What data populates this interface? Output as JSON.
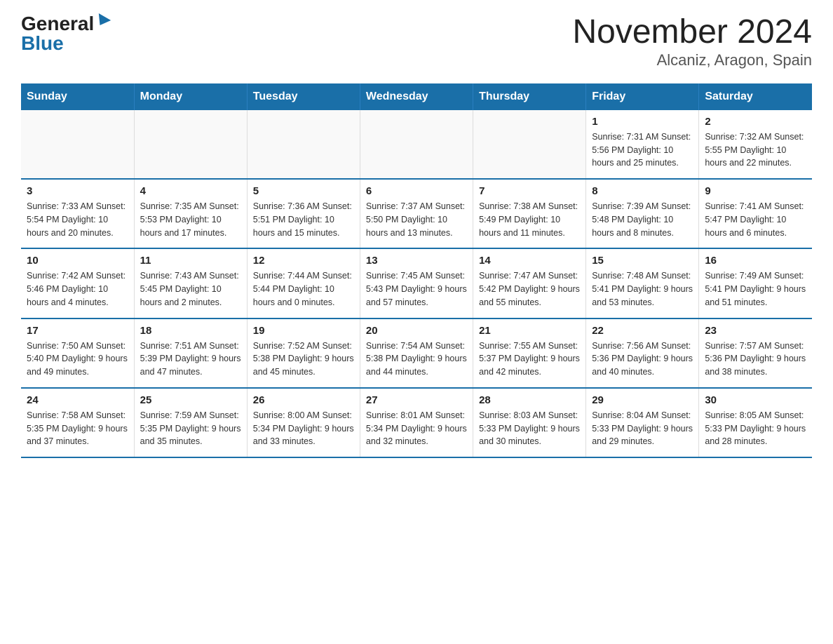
{
  "logo": {
    "general": "General",
    "blue": "Blue"
  },
  "title": "November 2024",
  "subtitle": "Alcaniz, Aragon, Spain",
  "days_of_week": [
    "Sunday",
    "Monday",
    "Tuesday",
    "Wednesday",
    "Thursday",
    "Friday",
    "Saturday"
  ],
  "weeks": [
    [
      {
        "day": "",
        "info": ""
      },
      {
        "day": "",
        "info": ""
      },
      {
        "day": "",
        "info": ""
      },
      {
        "day": "",
        "info": ""
      },
      {
        "day": "",
        "info": ""
      },
      {
        "day": "1",
        "info": "Sunrise: 7:31 AM\nSunset: 5:56 PM\nDaylight: 10 hours\nand 25 minutes."
      },
      {
        "day": "2",
        "info": "Sunrise: 7:32 AM\nSunset: 5:55 PM\nDaylight: 10 hours\nand 22 minutes."
      }
    ],
    [
      {
        "day": "3",
        "info": "Sunrise: 7:33 AM\nSunset: 5:54 PM\nDaylight: 10 hours\nand 20 minutes."
      },
      {
        "day": "4",
        "info": "Sunrise: 7:35 AM\nSunset: 5:53 PM\nDaylight: 10 hours\nand 17 minutes."
      },
      {
        "day": "5",
        "info": "Sunrise: 7:36 AM\nSunset: 5:51 PM\nDaylight: 10 hours\nand 15 minutes."
      },
      {
        "day": "6",
        "info": "Sunrise: 7:37 AM\nSunset: 5:50 PM\nDaylight: 10 hours\nand 13 minutes."
      },
      {
        "day": "7",
        "info": "Sunrise: 7:38 AM\nSunset: 5:49 PM\nDaylight: 10 hours\nand 11 minutes."
      },
      {
        "day": "8",
        "info": "Sunrise: 7:39 AM\nSunset: 5:48 PM\nDaylight: 10 hours\nand 8 minutes."
      },
      {
        "day": "9",
        "info": "Sunrise: 7:41 AM\nSunset: 5:47 PM\nDaylight: 10 hours\nand 6 minutes."
      }
    ],
    [
      {
        "day": "10",
        "info": "Sunrise: 7:42 AM\nSunset: 5:46 PM\nDaylight: 10 hours\nand 4 minutes."
      },
      {
        "day": "11",
        "info": "Sunrise: 7:43 AM\nSunset: 5:45 PM\nDaylight: 10 hours\nand 2 minutes."
      },
      {
        "day": "12",
        "info": "Sunrise: 7:44 AM\nSunset: 5:44 PM\nDaylight: 10 hours\nand 0 minutes."
      },
      {
        "day": "13",
        "info": "Sunrise: 7:45 AM\nSunset: 5:43 PM\nDaylight: 9 hours\nand 57 minutes."
      },
      {
        "day": "14",
        "info": "Sunrise: 7:47 AM\nSunset: 5:42 PM\nDaylight: 9 hours\nand 55 minutes."
      },
      {
        "day": "15",
        "info": "Sunrise: 7:48 AM\nSunset: 5:41 PM\nDaylight: 9 hours\nand 53 minutes."
      },
      {
        "day": "16",
        "info": "Sunrise: 7:49 AM\nSunset: 5:41 PM\nDaylight: 9 hours\nand 51 minutes."
      }
    ],
    [
      {
        "day": "17",
        "info": "Sunrise: 7:50 AM\nSunset: 5:40 PM\nDaylight: 9 hours\nand 49 minutes."
      },
      {
        "day": "18",
        "info": "Sunrise: 7:51 AM\nSunset: 5:39 PM\nDaylight: 9 hours\nand 47 minutes."
      },
      {
        "day": "19",
        "info": "Sunrise: 7:52 AM\nSunset: 5:38 PM\nDaylight: 9 hours\nand 45 minutes."
      },
      {
        "day": "20",
        "info": "Sunrise: 7:54 AM\nSunset: 5:38 PM\nDaylight: 9 hours\nand 44 minutes."
      },
      {
        "day": "21",
        "info": "Sunrise: 7:55 AM\nSunset: 5:37 PM\nDaylight: 9 hours\nand 42 minutes."
      },
      {
        "day": "22",
        "info": "Sunrise: 7:56 AM\nSunset: 5:36 PM\nDaylight: 9 hours\nand 40 minutes."
      },
      {
        "day": "23",
        "info": "Sunrise: 7:57 AM\nSunset: 5:36 PM\nDaylight: 9 hours\nand 38 minutes."
      }
    ],
    [
      {
        "day": "24",
        "info": "Sunrise: 7:58 AM\nSunset: 5:35 PM\nDaylight: 9 hours\nand 37 minutes."
      },
      {
        "day": "25",
        "info": "Sunrise: 7:59 AM\nSunset: 5:35 PM\nDaylight: 9 hours\nand 35 minutes."
      },
      {
        "day": "26",
        "info": "Sunrise: 8:00 AM\nSunset: 5:34 PM\nDaylight: 9 hours\nand 33 minutes."
      },
      {
        "day": "27",
        "info": "Sunrise: 8:01 AM\nSunset: 5:34 PM\nDaylight: 9 hours\nand 32 minutes."
      },
      {
        "day": "28",
        "info": "Sunrise: 8:03 AM\nSunset: 5:33 PM\nDaylight: 9 hours\nand 30 minutes."
      },
      {
        "day": "29",
        "info": "Sunrise: 8:04 AM\nSunset: 5:33 PM\nDaylight: 9 hours\nand 29 minutes."
      },
      {
        "day": "30",
        "info": "Sunrise: 8:05 AM\nSunset: 5:33 PM\nDaylight: 9 hours\nand 28 minutes."
      }
    ]
  ]
}
